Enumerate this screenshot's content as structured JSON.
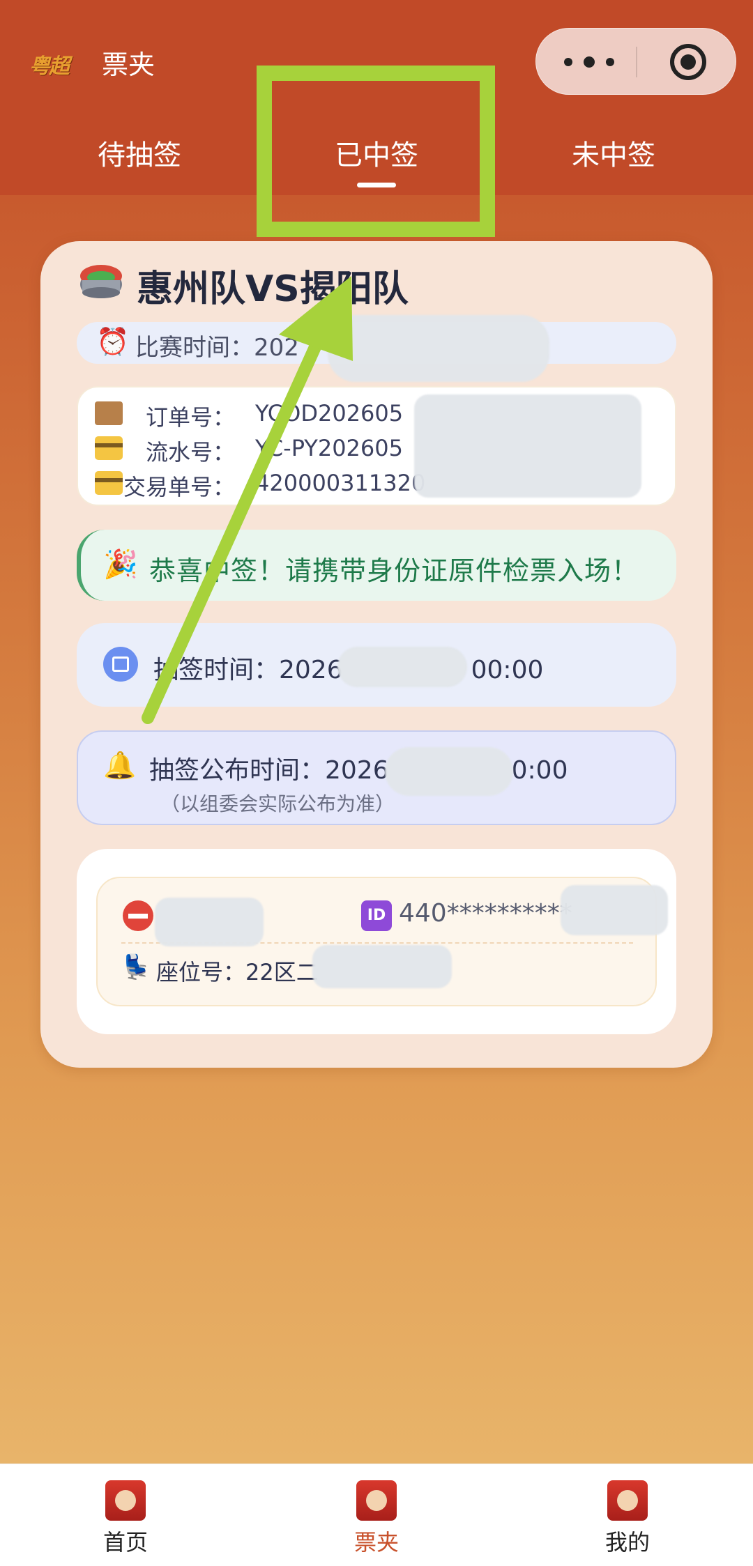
{
  "header": {
    "logo_text": "粤超",
    "title": "票夹"
  },
  "tabs": [
    {
      "label": "待抽签"
    },
    {
      "label": "已中签"
    },
    {
      "label": "未中签"
    }
  ],
  "ticket": {
    "match_title": "惠州队VS揭阳队",
    "match_time_label": "比赛时间：",
    "match_time_value": "202",
    "order_no_label": "订单号：",
    "order_no_value": "YCOD202605",
    "serial_no_label": "流水号：",
    "serial_no_value": "YC-PY202605",
    "trade_no_label": "交易单号：",
    "trade_no_value": "420000311320",
    "congrats_text": "恭喜中签！请携带身份证原件检票入场！",
    "draw_time_text": "抽签时间：2026",
    "draw_time_tail": "00:00",
    "announce_text": "抽签公布时间：2026",
    "announce_tail": "0:00",
    "announce_note": "（以组委会实际公布为准）",
    "id_number": "440**********",
    "seat_text": "座位号：22区二"
  },
  "bottom_nav": [
    {
      "label": "首页"
    },
    {
      "label": "票夹"
    },
    {
      "label": "我的"
    }
  ],
  "colors": {
    "header_bg": "#c14a28",
    "highlight": "#a7d23b",
    "active_nav": "#c8502a",
    "congrats_green": "#1e7a4a"
  }
}
